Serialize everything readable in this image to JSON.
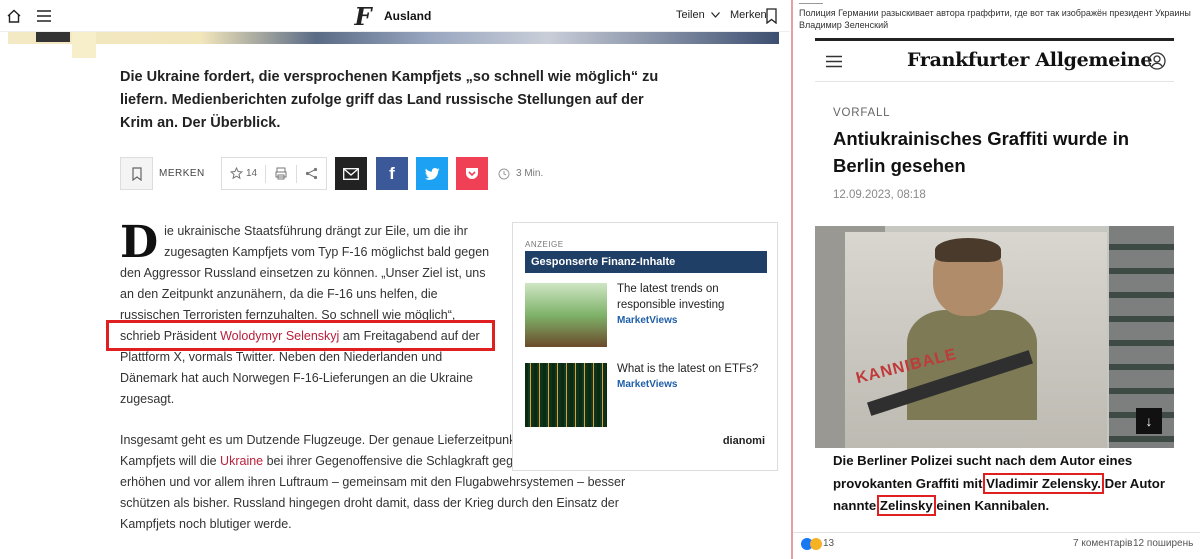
{
  "left": {
    "topbar": {
      "section": "Ausland",
      "teilen": "Teilen",
      "merken": "Merken"
    },
    "lead": "Die Ukraine fordert, die versprochenen Kampfjets „so schnell wie möglich“ zu liefern. Medienberichten zufolge griff das Land russische Stellungen auf der Krim an. Der Überblick.",
    "sharebar": {
      "merken": "MERKEN",
      "likes": "14",
      "read_time": "3 Min."
    },
    "body": {
      "dropcap": "D",
      "p1_a": "ie ukrainische Staatsführung drängt zur Eile, um die ihr zugesagten Kampfjets vom Typ F-16 möglichst bald gegen den Aggressor Russland einsetzen zu können. „Unser Ziel ist, uns an den Zeitpunkt anzunähern, da die F-16 uns helfen, die russischen Terroristen fernzuhalten. So schnell wie möglich“, schrieb Präsident ",
      "p1_link": "Wolodymyr Selenskyj",
      "p1_b": " am Freitagabend auf der Plattform X, vormals Twitter. Neben den Niederlanden und Dänemark hat auch Norwegen F-16-Lieferungen an die Ukraine zugesagt.",
      "p2_a": "Insgesamt geht es um Dutzende Flugzeuge. Der genaue Lieferzeitpunkt ist nicht klar. Mit den Kampfjets will die ",
      "p2_link": "Ukraine",
      "p2_b": " bei ihrer Gegenoffensive die Schlagkraft gegen die russischen Angriffe erhöhen und vor allem ihren Luftraum – gemeinsam mit den Flugabwehrsystemen – besser schützen als bisher. Russland hingegen droht damit, dass der Krieg durch den Einsatz der Kampfjets noch blutiger werde."
    },
    "ad": {
      "label": "ANZEIGE",
      "title": "Gesponserte Finanz-Inhalte",
      "items": [
        {
          "text": "The latest trends on responsible investing",
          "source": "MarketViews"
        },
        {
          "text": "What is the latest on ETFs?",
          "source": "MarketViews"
        }
      ],
      "brand": "dianomi"
    }
  },
  "right": {
    "caption": "Полиция Германии разыскивает автора граффити, где вот так изображён президент Украины Владимир Зеленский",
    "masthead": "Frankfurter Allgemeine",
    "kicker": "VORFALL",
    "title": "Antiukrainisches Graffiti wurde in Berlin gesehen",
    "date": "12.09.2023, 08:18",
    "graffiti_text": "KANNIBALE",
    "lead_a": "Die Berliner Polizei sucht nach dem Autor eines provokanten Graffiti mit ",
    "lead_name1": "Vladimir Zelensky.",
    "lead_b": " Der Autor nannte ",
    "lead_name2": "Zelinsky",
    "lead_c": " einen Kannibalen.",
    "footer": {
      "reactions": "13",
      "comments": "7 коментарів",
      "shares": "12 поширень"
    }
  },
  "colors": {
    "link_red": "#b8203b",
    "highlight_red": "#e02020",
    "ad_header": "#1f3f66",
    "facebook": "#3b5998",
    "twitter": "#1da1f2",
    "pocket": "#ef4056"
  }
}
